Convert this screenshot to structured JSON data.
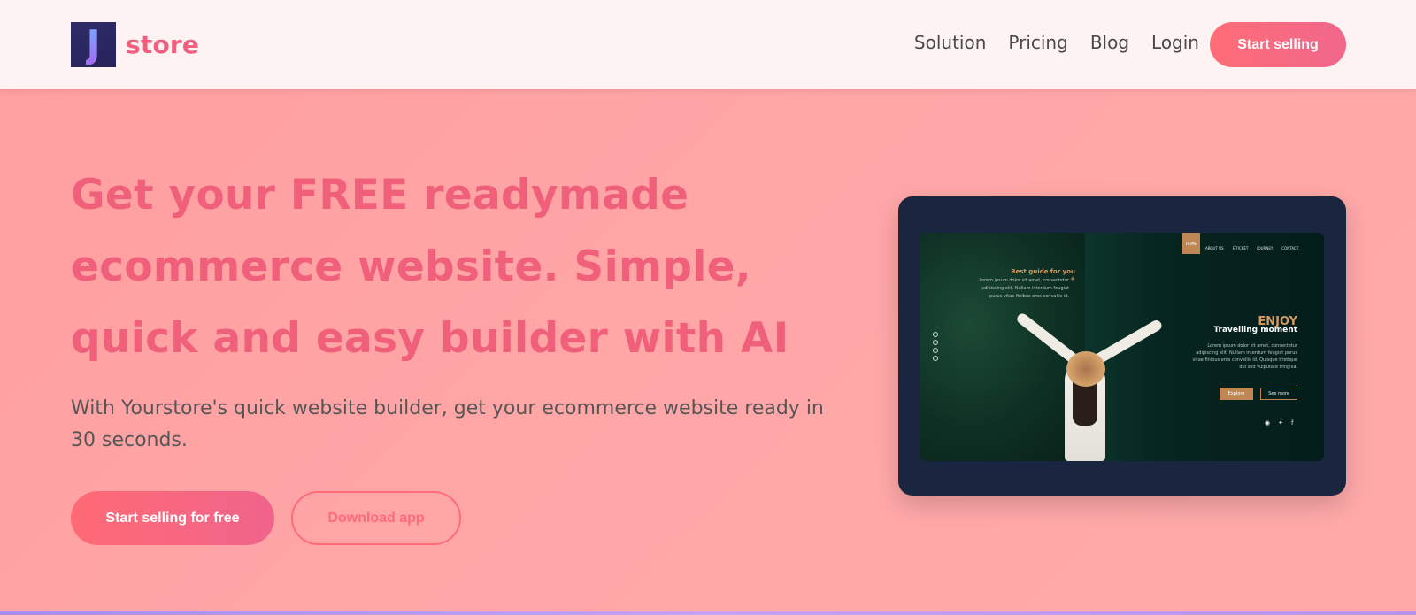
{
  "header": {
    "logo_letter": "J",
    "logo_text": "store",
    "nav": [
      "Solution",
      "Pricing",
      "Blog",
      "Login"
    ],
    "cta": "Start selling"
  },
  "hero": {
    "headline": "Get your FREE readymade ecommerce website. Simple, quick and easy builder with AI",
    "subtext": "With Yourstore's quick website builder, get your ecommerce website ready in 30 seconds.",
    "primary_button": "Start selling for free",
    "secondary_button": "Download app"
  },
  "mockup": {
    "nav_home": "HOME",
    "nav_items": [
      "ABOUT US",
      "E-TICKET",
      "JOURNEY",
      "CONTACT"
    ],
    "guide_title": "Best guide for you +",
    "guide_text": "Lorem ipsum dolor sit amet, consectetur adipiscing elit. Nullam interdum feugiat purus vitae finibus eros convallis id.",
    "enjoy": "ENJOY",
    "travelling": "Travelling moment",
    "body_text": "Lorem ipsum dolor sit amet, consectetur adipiscing elit. Nullam interdum feugiat purus vitae finibus eros convallis id. Quisque tristique dui sed vulputate fringilla.",
    "explore": "Explore",
    "see_more": "See more",
    "social_icons": [
      "instagram-icon",
      "twitter-icon",
      "facebook-icon"
    ]
  },
  "colors": {
    "brand": "#f0607e",
    "background": "#ffa4a5",
    "header_bg": "#fdf3f3",
    "mockup_bg": "#1a2640",
    "accent_gold": "#c08654"
  }
}
